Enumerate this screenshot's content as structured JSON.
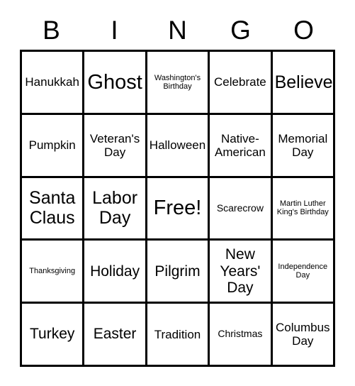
{
  "card": {
    "type": "bingo-card",
    "header_letters": [
      "B",
      "I",
      "N",
      "G",
      "O"
    ],
    "grid_size": "5x5",
    "free_space": {
      "row": 3,
      "column": 3,
      "label": "Free!"
    },
    "colors": {
      "background": "#ffffff",
      "border": "#000000",
      "text": "#000000"
    },
    "rows": [
      [
        {
          "label": "Hanukkah",
          "size": "md"
        },
        {
          "label": "Ghost",
          "size": "xxl"
        },
        {
          "label": "Washington's Birthday",
          "size": "xs"
        },
        {
          "label": "Celebrate",
          "size": "md"
        },
        {
          "label": "Believe",
          "size": "xl"
        }
      ],
      [
        {
          "label": "Pumpkin",
          "size": "md"
        },
        {
          "label": "Veteran's Day",
          "size": "md"
        },
        {
          "label": "Halloween",
          "size": "md"
        },
        {
          "label": "Native-American",
          "size": "md"
        },
        {
          "label": "Memorial Day",
          "size": "md"
        }
      ],
      [
        {
          "label": "Santa Claus",
          "size": "xl"
        },
        {
          "label": "Labor Day",
          "size": "xl"
        },
        {
          "label": "Free!",
          "size": "xxl"
        },
        {
          "label": "Scarecrow",
          "size": "sm"
        },
        {
          "label": "Martin Luther King's Birthday",
          "size": "xs"
        }
      ],
      [
        {
          "label": "Thanksgiving",
          "size": "xs"
        },
        {
          "label": "Holiday",
          "size": "lg"
        },
        {
          "label": "Pilgrim",
          "size": "lg"
        },
        {
          "label": "New Years' Day",
          "size": "lg"
        },
        {
          "label": "Independence Day",
          "size": "xs"
        }
      ],
      [
        {
          "label": "Turkey",
          "size": "lg"
        },
        {
          "label": "Easter",
          "size": "lg"
        },
        {
          "label": "Tradition",
          "size": "md"
        },
        {
          "label": "Christmas",
          "size": "sm"
        },
        {
          "label": "Columbus Day",
          "size": "md"
        }
      ]
    ]
  }
}
